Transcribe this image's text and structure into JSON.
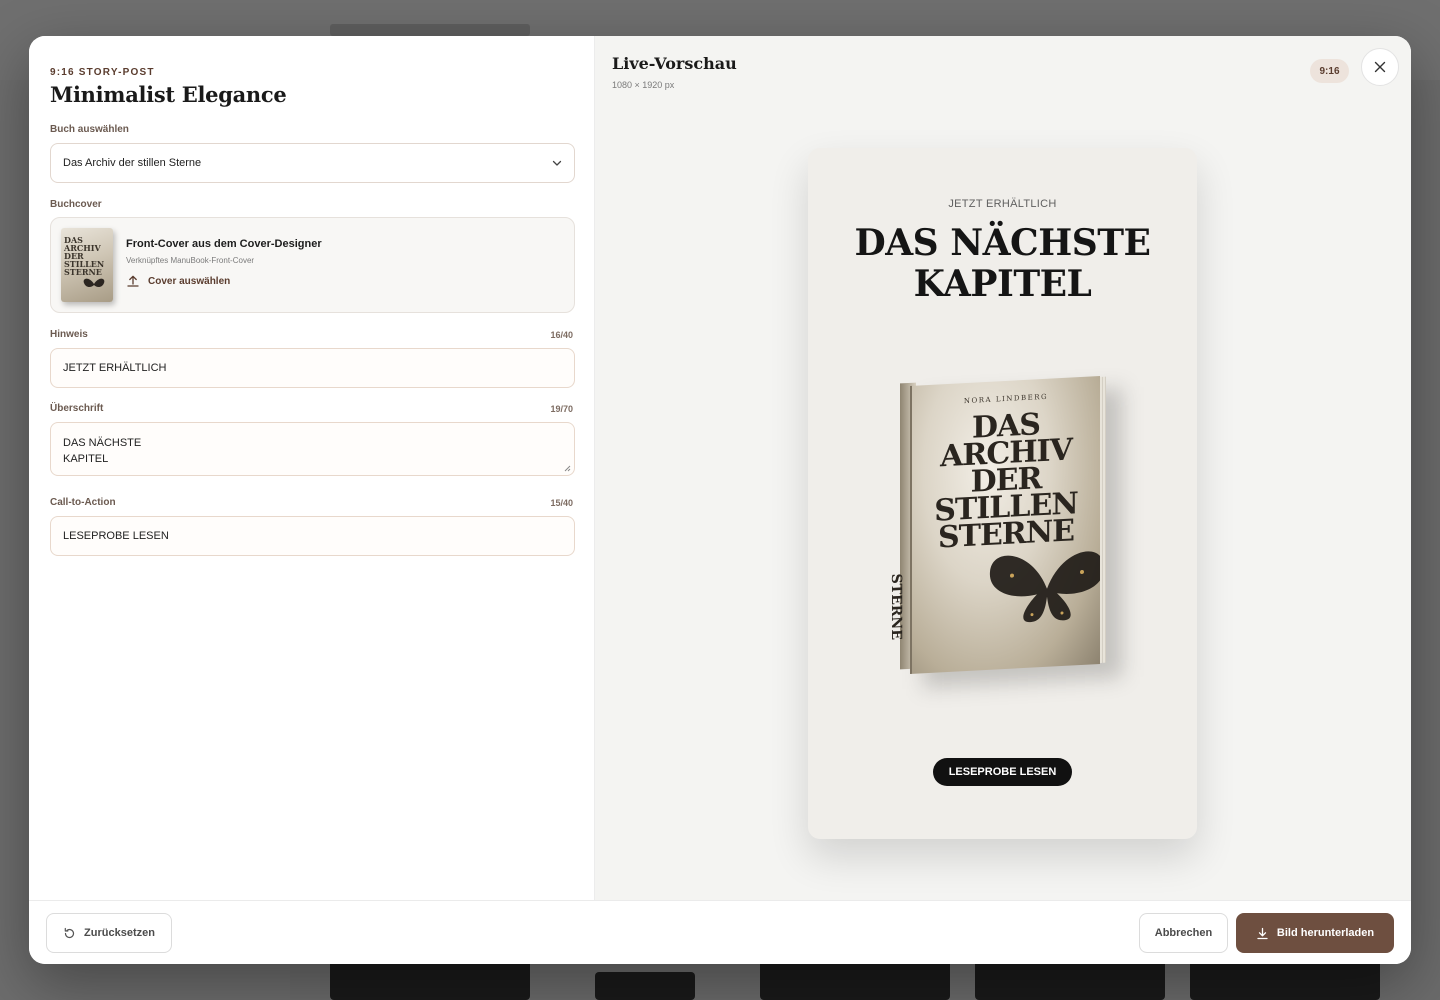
{
  "editor": {
    "eyebrow": "9:16 STORY-POST",
    "title": "Minimalist Elegance"
  },
  "book_select": {
    "label": "Buch auswählen",
    "value": "Das Archiv der stillen Sterne"
  },
  "cover": {
    "label": "Buchcover",
    "title": "Front-Cover aus dem Cover-Designer",
    "subtitle": "Verknüpftes ManuBook-Front-Cover",
    "action": "Cover auswählen",
    "thumb_text": "DAS\nARCHIV\nDER\nSTILLEN\nSTERNE"
  },
  "hint": {
    "label": "Hinweis",
    "counter": "16/40",
    "value": "JETZT ERHÄLTLICH"
  },
  "headline": {
    "label": "Überschrift",
    "counter": "19/70",
    "line1": "DAS NÄCHSTE",
    "line2": "KAPITEL"
  },
  "cta": {
    "label": "Call-to-Action",
    "counter": "15/40",
    "value": "LESEPROBE LESEN"
  },
  "preview": {
    "title": "Live-Vorschau",
    "size": "1080 × 1920 px",
    "ratio": "9:16",
    "story": {
      "hint": "JETZT ERHÄLTLICH",
      "headline": "DAS NÄCHSTE\nKAPITEL",
      "cta": "LESEPROBE LESEN",
      "book_author": "NORA LINDBERG",
      "book_title": "DAS\nARCHIV\nDER\nSTILLEN\nSTERNE",
      "book_spine": "STERNE"
    }
  },
  "footer": {
    "reset": "Zurücksetzen",
    "cancel": "Abbrechen",
    "download": "Bild herunterladen"
  },
  "colors": {
    "accent": "#6e4f40",
    "eyebrow": "#5a3c2e",
    "preview_bg": "#f4f4f2"
  }
}
